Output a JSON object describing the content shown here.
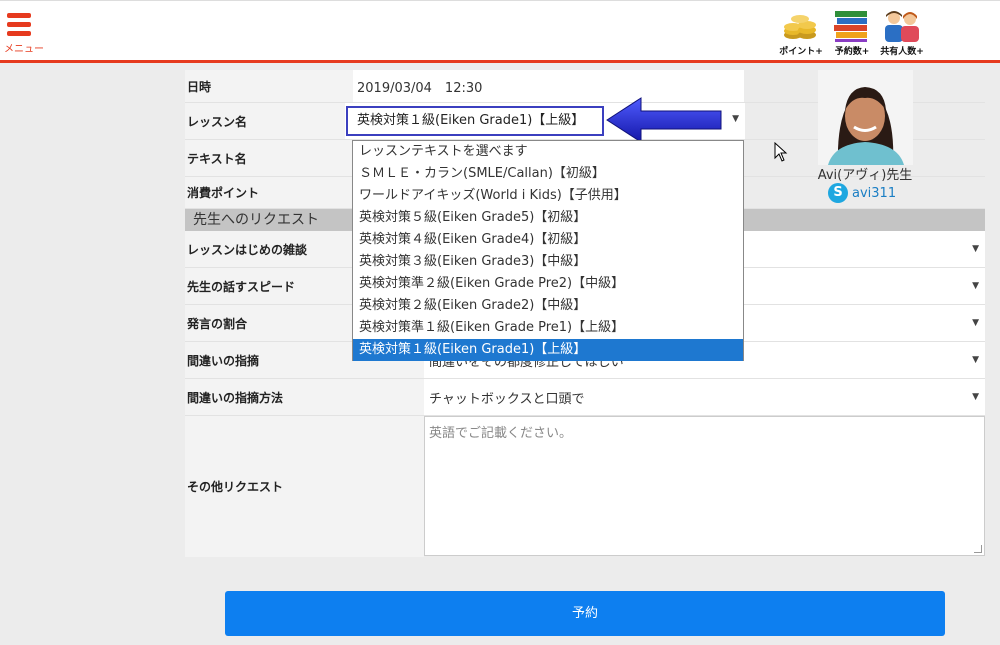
{
  "header": {
    "menu_label": "メニュー",
    "icons": [
      {
        "label": "ポイント+",
        "icon": "coins-icon"
      },
      {
        "label": "予約数+",
        "icon": "books-icon"
      },
      {
        "label": "共有人数+",
        "icon": "people-icon"
      }
    ]
  },
  "form": {
    "date": {
      "label": "日時",
      "value": "2019/03/04　12:30"
    },
    "lesson": {
      "label": "レッスン名",
      "value": "英検対策１級(Eiken Grade1)【上級】"
    },
    "text": {
      "label": "テキスト名"
    },
    "points": {
      "label": "消費ポイント"
    },
    "request_section": "先生へのリクエスト",
    "small_talk": {
      "label": "レッスンはじめの雑談"
    },
    "speed": {
      "label": "先生の話すスピード"
    },
    "ratio": {
      "label": "発言の割合"
    },
    "correction": {
      "label": "間違いの指摘",
      "value": "間違いをその都度修正してほしい"
    },
    "correction_method": {
      "label": "間違いの指摘方法",
      "value": "チャットボックスと口頭で"
    },
    "other": {
      "label": "その他リクエスト",
      "placeholder": "英語でご記載ください。"
    }
  },
  "dropdown_options": [
    "レッスンテキストを選べます",
    "ＳＭＬＥ・カラン(SMLE/Callan)【初級】",
    "ワールドアイキッズ(World i Kids)【子供用】",
    "英検対策５級(Eiken Grade5)【初級】",
    "英検対策４級(Eiken Grade4)【初級】",
    "英検対策３級(Eiken Grade3)【中級】",
    "英検対策準２級(Eiken Grade Pre2)【中級】",
    "英検対策２級(Eiken Grade2)【中級】",
    "英検対策準１級(Eiken Grade Pre1)【上級】",
    "英検対策１級(Eiken Grade1)【上級】"
  ],
  "teacher": {
    "name": "Avi(アヴィ)先生",
    "skype": "avi311"
  },
  "submit_label": "予約",
  "colors": {
    "accent": "#e63a1e",
    "primary": "#0d7ff0",
    "highlight_border": "#3b3fbf",
    "skype": "#1ea7e0"
  }
}
